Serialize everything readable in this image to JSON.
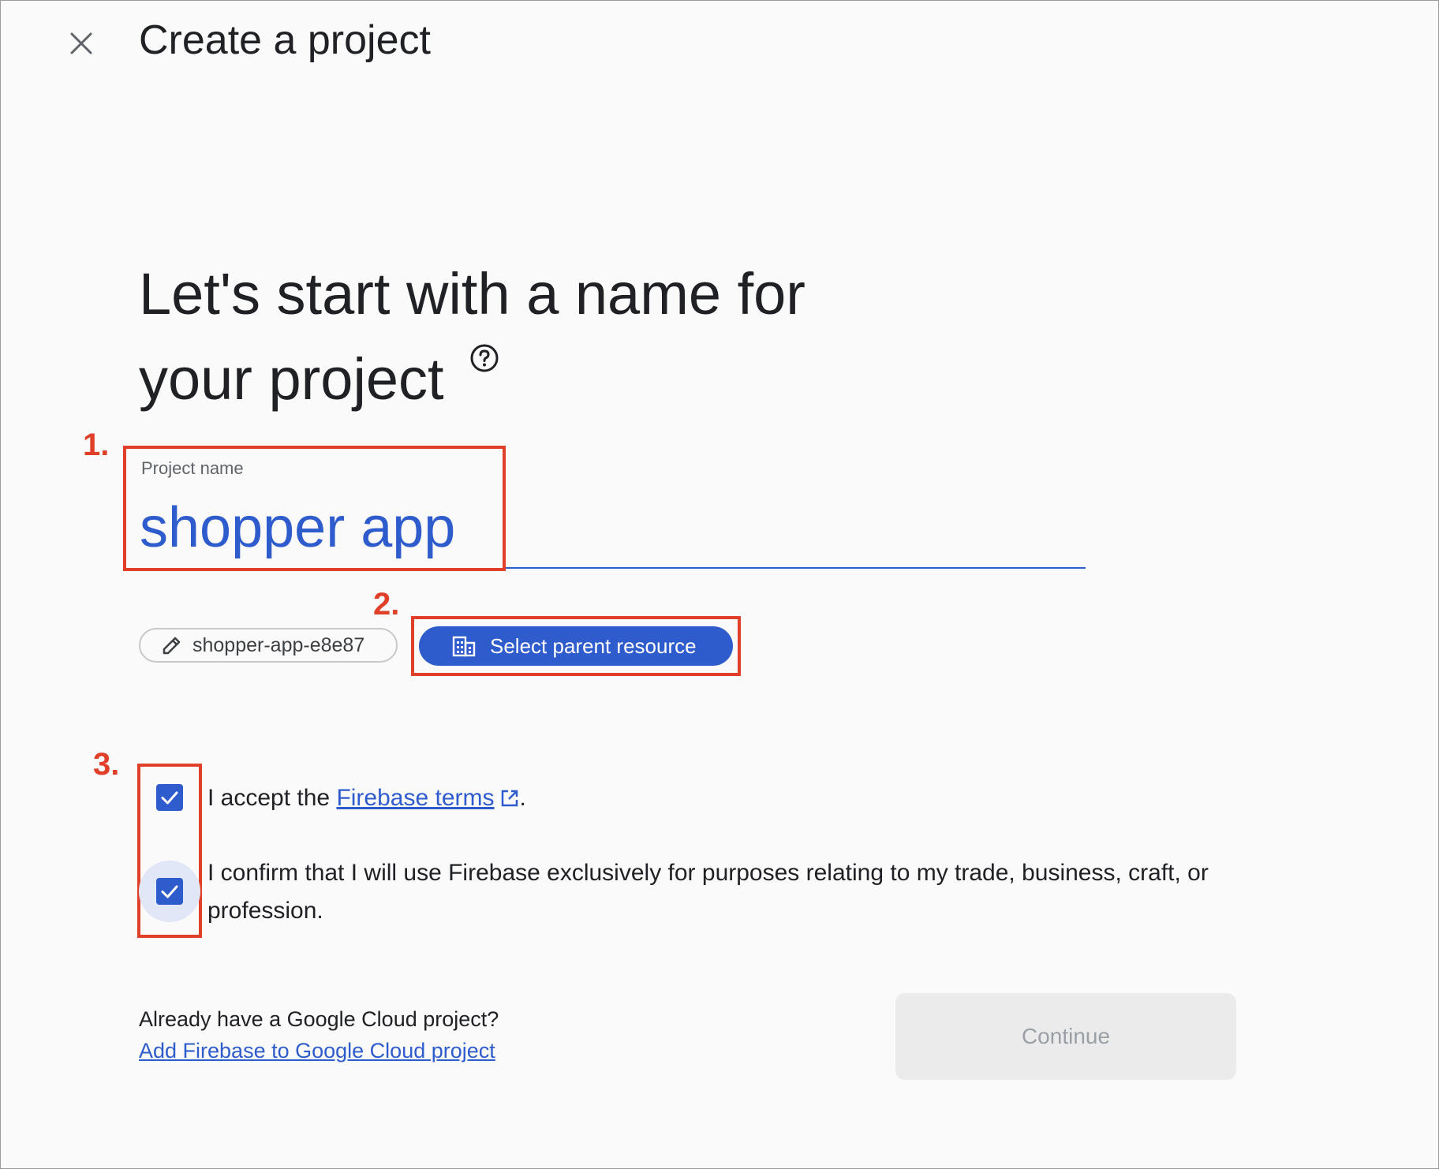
{
  "header": {
    "title": "Create a project",
    "close_icon": "close-icon"
  },
  "heading": {
    "line1": "Let's start with a name for",
    "line2": "your project",
    "help_icon": "help-circle-icon"
  },
  "project_name": {
    "label": "Project name",
    "value": "shopper app"
  },
  "project_id": {
    "icon": "pencil-icon",
    "value": "shopper-app-e8e87"
  },
  "parent_resource": {
    "icon": "building-icon",
    "label": "Select parent resource"
  },
  "checkboxes": {
    "terms": {
      "checked": true,
      "text_before": "I accept the ",
      "link_text": "Firebase terms",
      "link_icon": "external-link-icon",
      "text_after": "."
    },
    "business_use": {
      "checked": true,
      "text": "I confirm that I will use Firebase exclusively for purposes relating to my trade, business, craft, or profession."
    }
  },
  "footer": {
    "question": "Already have a Google Cloud project?",
    "link_text": "Add Firebase to Google Cloud project",
    "continue_label": "Continue",
    "continue_enabled": false
  },
  "annotations": [
    {
      "number": "1.",
      "target": "project-name-field"
    },
    {
      "number": "2.",
      "target": "select-parent-resource-button"
    },
    {
      "number": "3.",
      "target": "checkboxes"
    }
  ],
  "colors": {
    "accent": "#2f5ccc",
    "annotation": "#e0402a",
    "background": "#fafafa",
    "disabled_button": "#ebebeb"
  }
}
